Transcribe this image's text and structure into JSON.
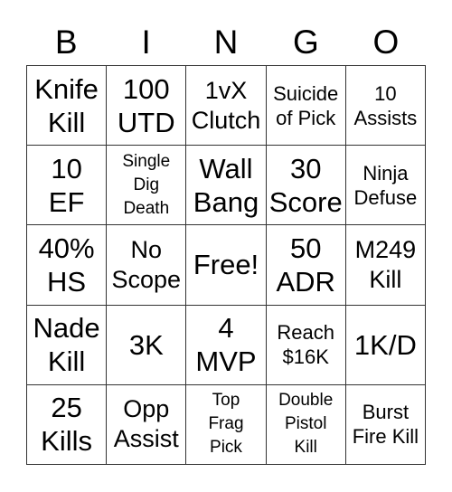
{
  "header": [
    "B",
    "I",
    "N",
    "G",
    "O"
  ],
  "cells": [
    {
      "text": "Knife Kill",
      "size": "xl"
    },
    {
      "text": "100 UTD",
      "size": "xl"
    },
    {
      "text": "1vX Clutch",
      "size": "lg"
    },
    {
      "text": "Suicide of Pick",
      "size": "md"
    },
    {
      "text": "10 Assists",
      "size": "md"
    },
    {
      "text": "10 EF",
      "size": "xl"
    },
    {
      "text": "Single Dig Death",
      "size": "sm"
    },
    {
      "text": "Wall Bang",
      "size": "xl"
    },
    {
      "text": "30 Score",
      "size": "xl"
    },
    {
      "text": "Ninja Defuse",
      "size": "md"
    },
    {
      "text": "40% HS",
      "size": "xl"
    },
    {
      "text": "No Scope",
      "size": "lg"
    },
    {
      "text": "Free!",
      "size": "xl"
    },
    {
      "text": "50 ADR",
      "size": "xl"
    },
    {
      "text": "M249 Kill",
      "size": "lg"
    },
    {
      "text": "Nade Kill",
      "size": "xl"
    },
    {
      "text": "3K",
      "size": "xl"
    },
    {
      "text": "4 MVP",
      "size": "xl"
    },
    {
      "text": "Reach $16K",
      "size": "md"
    },
    {
      "text": "1K/D",
      "size": "xl"
    },
    {
      "text": "25 Kills",
      "size": "xl"
    },
    {
      "text": "Opp Assist",
      "size": "lg"
    },
    {
      "text": "Top Frag Pick",
      "size": "sm"
    },
    {
      "text": "Double Pistol Kill",
      "size": "sm"
    },
    {
      "text": "Burst Fire Kill",
      "size": "md"
    }
  ],
  "lines": {
    "0": [
      "Knife",
      "Kill"
    ],
    "1": [
      "100",
      "UTD"
    ],
    "2": [
      "1vX",
      "Clutch"
    ],
    "3": [
      "Suicide",
      "of Pick"
    ],
    "4": [
      "10",
      "Assists"
    ],
    "5": [
      "10",
      "EF"
    ],
    "6": [
      "Single",
      "Dig",
      "Death"
    ],
    "7": [
      "Wall",
      "Bang"
    ],
    "8": [
      "30",
      "Score"
    ],
    "9": [
      "Ninja",
      "Defuse"
    ],
    "10": [
      "40%",
      "HS"
    ],
    "11": [
      "No",
      "Scope"
    ],
    "12": [
      "Free!"
    ],
    "13": [
      "50",
      "ADR"
    ],
    "14": [
      "M249",
      "Kill"
    ],
    "15": [
      "Nade",
      "Kill"
    ],
    "16": [
      "3K"
    ],
    "17": [
      "4",
      "MVP"
    ],
    "18": [
      "Reach",
      "$16K"
    ],
    "19": [
      "1K/D"
    ],
    "20": [
      "25",
      "Kills"
    ],
    "21": [
      "Opp",
      "Assist"
    ],
    "22": [
      "Top",
      "Frag",
      "Pick"
    ],
    "23": [
      "Double",
      "Pistol",
      "Kill"
    ],
    "24": [
      "Burst",
      "Fire Kill"
    ]
  }
}
